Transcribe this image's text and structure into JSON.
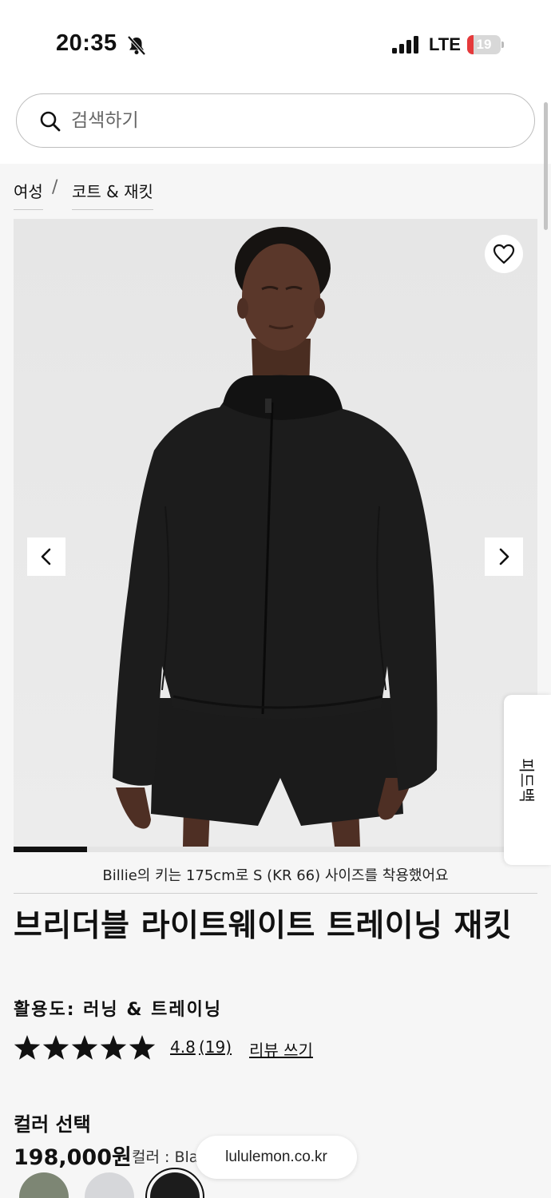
{
  "status_bar": {
    "time": "20:35",
    "network": "LTE",
    "battery_level": "19",
    "battery_fraction": 0.19,
    "icons": [
      "bell-slash-icon",
      "cellular-signal-icon",
      "battery-icon"
    ]
  },
  "search": {
    "placeholder": "검색하기",
    "icon": "search-icon"
  },
  "breadcrumb": {
    "items": [
      "여성",
      "코트 & 재킷"
    ],
    "separator": "/"
  },
  "gallery": {
    "image_subject": "black lightweight hooded jacket on model",
    "progress_fraction": 0.14,
    "icons": [
      "heart-icon",
      "chevron-left-icon",
      "chevron-right-icon"
    ]
  },
  "side_tab": {
    "label": "피드백"
  },
  "model_caption": "Billie의 키는 175cm로 S (KR 66) 사이즈를 착용했어요",
  "product": {
    "title": "브리더블 라이트웨이트 트레이닝 재킷",
    "activity": "활용도: 러닝 & 트레이닝",
    "rating": "4.8",
    "rating_stars": 5,
    "review_count": "(19)",
    "write_review_label": "리뷰 쓰기",
    "color_heading": "컬러 선택",
    "price": "198,000원",
    "color_label": "컬러 : Bla"
  },
  "browser": {
    "url": "lululemon.co.kr"
  },
  "swatches": [
    {
      "color": "#7d8674",
      "selected": false
    },
    {
      "color": "#d6d7da",
      "selected": false
    },
    {
      "color": "#1c1c1c",
      "selected": true
    }
  ],
  "colors": {
    "accent": "#111111",
    "battery_low": "#e5393b",
    "background": "#f6f6f6"
  }
}
